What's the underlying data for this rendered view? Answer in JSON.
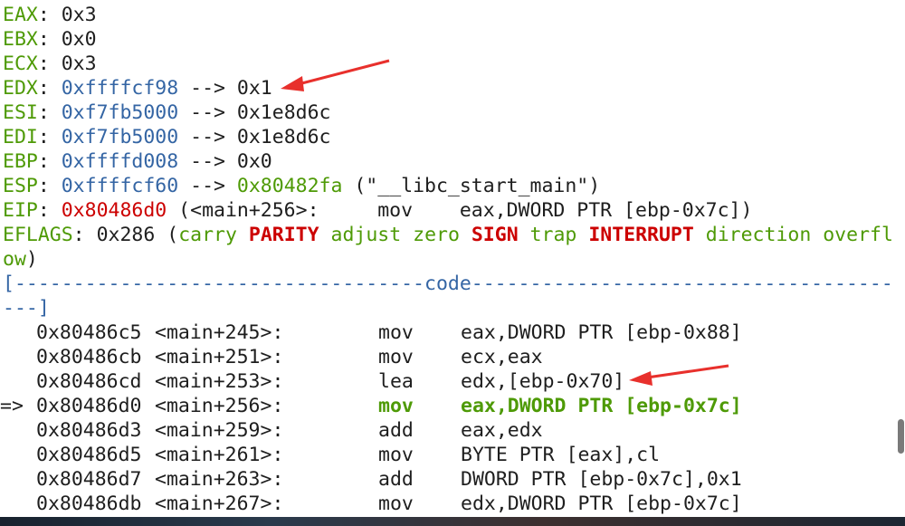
{
  "registers": [
    {
      "name": "EAX",
      "value": "0x3",
      "value_color": "plain"
    },
    {
      "name": "EBX",
      "value": "0x0",
      "value_color": "plain"
    },
    {
      "name": "ECX",
      "value": "0x3",
      "value_color": "plain"
    },
    {
      "name": "EDX",
      "value": "0xffffcf98",
      "value_color": "blue",
      "arrow": " --> ",
      "target": "0x1",
      "target_color": "plain"
    },
    {
      "name": "ESI",
      "value": "0xf7fb5000",
      "value_color": "blue",
      "arrow": " --> ",
      "target": "0x1e8d6c",
      "target_color": "plain"
    },
    {
      "name": "EDI",
      "value": "0xf7fb5000",
      "value_color": "blue",
      "arrow": " --> ",
      "target": "0x1e8d6c",
      "target_color": "plain"
    },
    {
      "name": "EBP",
      "value": "0xffffd008",
      "value_color": "blue",
      "arrow": " --> ",
      "target": "0x0",
      "target_color": "plain"
    },
    {
      "name": "ESP",
      "value": "0xffffcf60",
      "value_color": "blue",
      "arrow": " --> ",
      "target": "0x80482fa",
      "target_color": "green",
      "extra": " (\"__libc_start_main\")"
    }
  ],
  "eip": {
    "name": "EIP",
    "value": "0x80486d0",
    "rest": " (<main+256>:     mov    eax,DWORD PTR [ebp-0x7c])"
  },
  "eflags": {
    "name": "EFLAGS",
    "value": " 0x286 (",
    "flags": [
      {
        "text": "carry",
        "set": false
      },
      {
        "text": "PARITY",
        "set": true
      },
      {
        "text": "adjust",
        "set": false
      },
      {
        "text": "zero",
        "set": false
      },
      {
        "text": "SIGN",
        "set": true
      },
      {
        "text": "trap",
        "set": false
      },
      {
        "text": "INTERRUPT",
        "set": true
      },
      {
        "text": "direction",
        "set": false
      },
      {
        "text": "overfl",
        "set": false
      }
    ],
    "wrap": "ow",
    "close": ")"
  },
  "code_header": {
    "left": "[-----------------------------------",
    "title": "code",
    "right": "---------------------------------------",
    "wrap": "---]"
  },
  "code_lines": [
    {
      "marker": "",
      "addr": "0x80486c5",
      "sym": "<main+245>:",
      "mnemonic": "mov",
      "operands": "eax,DWORD PTR [ebp-0x88]",
      "current": false
    },
    {
      "marker": "",
      "addr": "0x80486cb",
      "sym": "<main+251>:",
      "mnemonic": "mov",
      "operands": "ecx,eax",
      "current": false
    },
    {
      "marker": "",
      "addr": "0x80486cd",
      "sym": "<main+253>:",
      "mnemonic": "lea",
      "operands": "edx,[ebp-0x70]",
      "current": false
    },
    {
      "marker": "=>",
      "addr": "0x80486d0",
      "sym": "<main+256>:",
      "mnemonic": "mov",
      "operands": "eax,DWORD PTR [ebp-0x7c]",
      "current": true
    },
    {
      "marker": "",
      "addr": "0x80486d3",
      "sym": "<main+259>:",
      "mnemonic": "add",
      "operands": "eax,edx",
      "current": false
    },
    {
      "marker": "",
      "addr": "0x80486d5",
      "sym": "<main+261>:",
      "mnemonic": "mov",
      "operands": "BYTE PTR [eax],cl",
      "current": false
    },
    {
      "marker": "",
      "addr": "0x80486d7",
      "sym": "<main+263>:",
      "mnemonic": "add",
      "operands": "DWORD PTR [ebp-0x7c],0x1",
      "current": false
    },
    {
      "marker": "",
      "addr": "0x80486db",
      "sym": "<main+267>:",
      "mnemonic": "mov",
      "operands": "edx,DWORD PTR [ebp-0x7c]",
      "current": false
    }
  ],
  "annotation_color": "#e8302c"
}
